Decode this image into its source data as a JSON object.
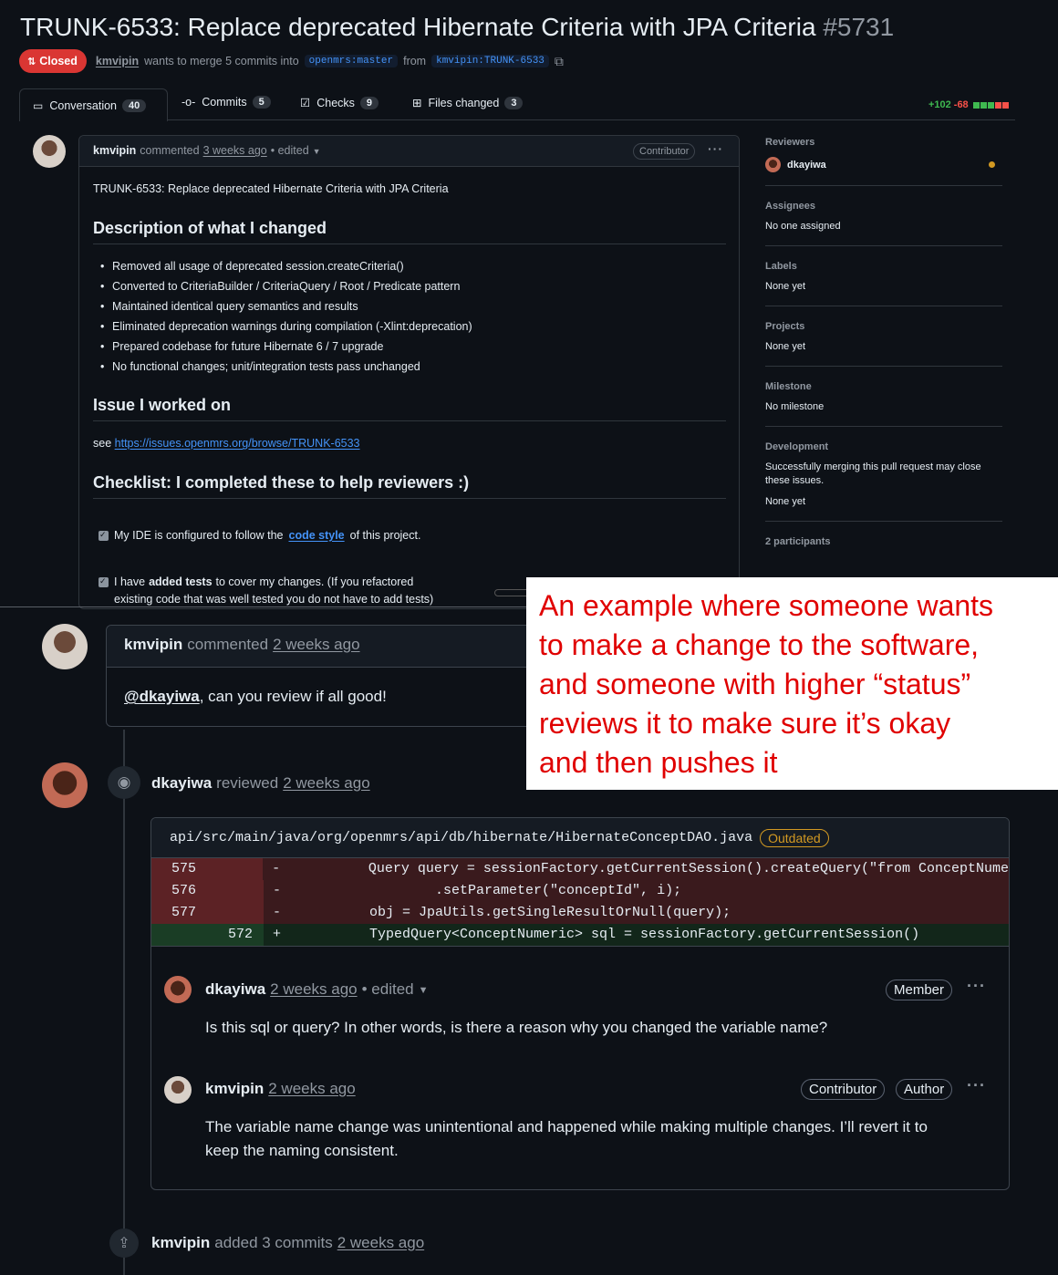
{
  "pr": {
    "title": "TRUNK-6533: Replace deprecated Hibernate Criteria with JPA Criteria",
    "number": "#5731",
    "status": "Closed",
    "author": "kmvipin",
    "merge_text": "wants to merge 5 commits into",
    "base_branch": "openmrs:master",
    "from_text": "from",
    "head_branch": "kmvipin:TRUNK-6533"
  },
  "tabs": [
    {
      "label": "Conversation",
      "count": "40"
    },
    {
      "label": "Commits",
      "count": "5"
    },
    {
      "label": "Checks",
      "count": "9"
    },
    {
      "label": "Files changed",
      "count": "3"
    }
  ],
  "diffstat": {
    "add": "+102",
    "del": "-68"
  },
  "first_comment": {
    "author": "kmvipin",
    "action": "commented",
    "time": "3 weeks ago",
    "edited": "• edited",
    "badge": "Contributor",
    "intro": "TRUNK-6533: Replace deprecated Hibernate Criteria with JPA Criteria",
    "h_desc": "Description of what I changed",
    "bullets": [
      "Removed all usage of deprecated session.createCriteria()",
      "Converted to CriteriaBuilder / CriteriaQuery / Root / Predicate pattern",
      "Maintained identical query semantics and results",
      "Eliminated deprecation warnings during compilation (-Xlint:deprecation)",
      "Prepared codebase for future Hibernate 6 / 7 upgrade",
      "No functional changes; unit/integration tests pass unchanged"
    ],
    "h_issue": "Issue I worked on",
    "see": "see",
    "issue_link": "https://issues.openmrs.org/browse/TRUNK-6533",
    "h_check": "Checklist: I completed these to help reviewers :)",
    "check1_pre": "My IDE is configured to follow the",
    "check1_link": "code style",
    "check1_post": "of this project.",
    "check2_pre": "I have",
    "check2_bold": "added tests",
    "check2_post": "to cover my changes. (If you refactored",
    "check2_line2": "existing code that was well tested you do not have to add tests)"
  },
  "sidebar": {
    "reviewers_h": "Reviewers",
    "reviewer": "dkayiwa",
    "assignees_h": "Assignees",
    "assignees_v": "No one assigned",
    "labels_h": "Labels",
    "labels_v": "None yet",
    "projects_h": "Projects",
    "projects_v": "None yet",
    "milestone_h": "Milestone",
    "milestone_v": "No milestone",
    "dev_h": "Development",
    "dev_v1": "Successfully merging this pull request may close",
    "dev_v2": "these issues.",
    "dev_v3": "None yet",
    "participants": "2 participants"
  },
  "annotation": {
    "lines": [
      "An example where someone wants",
      "to make a change to the software,",
      "and someone with higher “status”",
      "reviews it to make sure it’s okay",
      "and then pushes it"
    ]
  },
  "second_comment": {
    "author": "kmvipin",
    "action": "commented",
    "time": "2 weeks ago",
    "mention": "@dkayiwa",
    "text": ", can you review if all good!"
  },
  "review": {
    "author": "dkayiwa",
    "action": "reviewed",
    "time": "2 weeks ago",
    "file": "api/src/main/java/org/openmrs/api/db/hibernate/HibernateConceptDAO.java",
    "outdated": "Outdated",
    "diff": [
      {
        "num": "575",
        "sign": "-",
        "code": "        Query query = sessionFactory.getCurrentSession().createQuery(\"from ConceptNume",
        "type": "del"
      },
      {
        "num": "576",
        "sign": "-",
        "code": "                .setParameter(\"conceptId\", i);",
        "type": "del"
      },
      {
        "num": "577",
        "sign": "-",
        "code": "        obj = JpaUtils.getSingleResultOrNull(query);",
        "type": "del"
      },
      {
        "num": "572",
        "sign": "+",
        "code": "        TypedQuery<ConceptNumeric> sql = sessionFactory.getCurrentSession()",
        "type": "add"
      }
    ],
    "c1_author": "dkayiwa",
    "c1_time": "2 weeks ago",
    "c1_edited": "• edited",
    "c1_badge": "Member",
    "c1_text": "Is this sql or query? In other words, is there a reason why you changed the variable name?",
    "c2_author": "kmvipin",
    "c2_time": "2 weeks ago",
    "c2_badge1": "Contributor",
    "c2_badge2": "Author",
    "c2_text1": "The variable name change was unintentional and happened while making multiple changes. I’ll revert it to",
    "c2_text2": "keep the naming consistent."
  },
  "commits_event": {
    "author": "kmvipin",
    "text": "added 3 commits",
    "time": "2 weeks ago"
  },
  "colors": {
    "bg": "#0d1117",
    "closed": "#da3633",
    "link": "#4493f8",
    "annotation": "#e00000",
    "diff_del": "#3a1a1d",
    "diff_add": "#12261a",
    "outdated": "#d29922"
  }
}
